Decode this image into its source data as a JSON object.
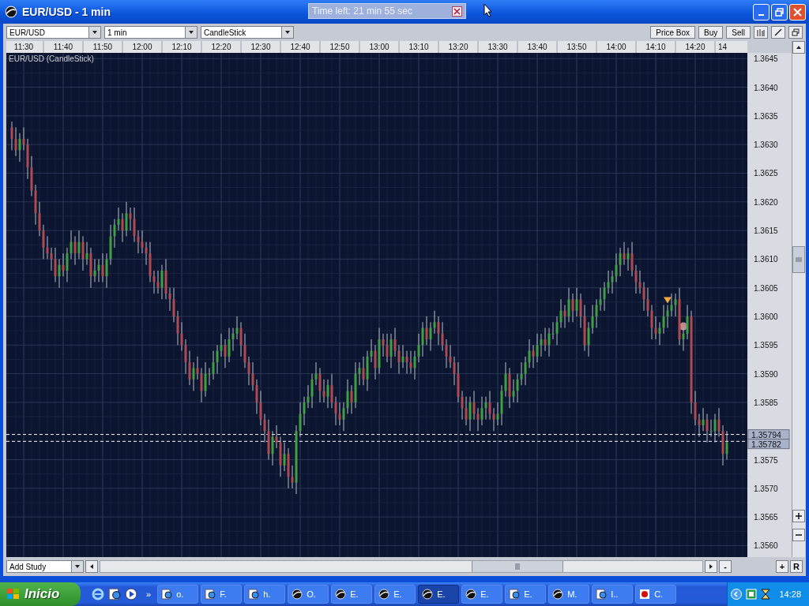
{
  "window": {
    "title": "EUR/USD - 1 min"
  },
  "timer_popup": {
    "text": "Time left: 21 min 55 sec"
  },
  "toolbar": {
    "symbol_select": "EUR/USD",
    "interval_select": "1 min",
    "chart_type_select": "CandleStick",
    "buttons": [
      "Price Box",
      "Buy",
      "Sell"
    ]
  },
  "chart": {
    "cut_time_label": "14",
    "chart_data": {
      "type": "candlestick",
      "title": "EUR/USD (CandleStick)",
      "x": [
        11.45,
        11.4667,
        11.4833,
        11.5,
        11.5167,
        11.5333,
        11.55,
        11.5667,
        11.5833,
        11.6,
        11.6167,
        11.6333,
        11.65,
        11.6667,
        11.6833,
        11.7,
        11.7167,
        11.7333,
        11.75,
        11.7667,
        11.7833,
        11.8,
        11.8167,
        11.8333,
        11.85,
        11.8667,
        11.8833,
        11.9,
        11.9167,
        11.9333,
        11.95,
        11.9667,
        11.9833,
        12,
        12.0167,
        12.0333,
        12.05,
        12.0667,
        12.0833,
        12.1,
        12.1167,
        12.1333,
        12.15,
        12.1667,
        12.1833,
        12.2,
        12.2167,
        12.2333,
        12.25,
        12.2667,
        12.2833,
        12.3,
        12.3167,
        12.3333,
        12.35,
        12.3667,
        12.3833,
        12.4,
        12.4167,
        12.4333,
        12.45,
        12.4667,
        12.4833,
        12.5,
        12.5167,
        12.5333,
        12.55,
        12.5667,
        12.5833,
        12.6,
        12.6167,
        12.6333,
        12.65,
        12.6667,
        12.6833,
        12.7,
        12.7167,
        12.7333,
        12.75,
        12.7667,
        12.7833,
        12.8,
        12.8167,
        12.8333,
        12.85,
        12.8667,
        12.8833,
        12.9,
        12.9167,
        12.9333,
        12.95,
        12.9667,
        12.9833,
        13,
        13.0167,
        13.0333,
        13.05,
        13.0667,
        13.0833,
        13.1,
        13.1167,
        13.1333,
        13.15,
        13.1667,
        13.1833,
        13.2,
        13.2167,
        13.2333,
        13.25,
        13.2667,
        13.2833,
        13.3,
        13.3167,
        13.3333,
        13.35,
        13.3667,
        13.3833,
        13.4,
        13.4167,
        13.4333,
        13.45,
        13.4667,
        13.4833,
        13.5,
        13.5167,
        13.5333,
        13.55,
        13.5667,
        13.5833,
        13.6,
        13.6167,
        13.6333,
        13.65,
        13.6667,
        13.6833,
        13.7,
        13.7167,
        13.7333,
        13.75,
        13.7667,
        13.7833,
        13.8,
        13.8167,
        13.8333,
        13.85,
        13.8667,
        13.8833,
        13.9,
        13.9167,
        13.9333,
        13.95,
        13.9667,
        13.9833,
        14,
        14.0167,
        14.0333,
        14.05,
        14.0667,
        14.0833,
        14.1,
        14.1167,
        14.1333,
        14.15,
        14.1667,
        14.1833,
        14.2,
        14.2167,
        14.2333,
        14.25,
        14.2667,
        14.2833,
        14.3,
        14.3167,
        14.3333,
        14.35,
        14.3667,
        14.3833,
        14.4,
        14.4167,
        14.4333,
        14.45,
        14.4667
      ],
      "grid": true,
      "xlim": [
        11.4267,
        14.5533
      ],
      "ohlc": [
        [
          1.3633,
          1.3634,
          1.3629,
          1.3631
        ],
        [
          1.3631,
          1.3633,
          1.3628,
          1.3629
        ],
        [
          1.3629,
          1.3632,
          1.3627,
          1.3631
        ],
        [
          1.3631,
          1.3633,
          1.3629,
          1.363
        ],
        [
          1.363,
          1.3631,
          1.3624,
          1.3626
        ],
        [
          1.3626,
          1.3628,
          1.3621,
          1.3622
        ],
        [
          1.3622,
          1.3623,
          1.3616,
          1.3618
        ],
        [
          1.3618,
          1.362,
          1.3614,
          1.3615
        ],
        [
          1.3615,
          1.3616,
          1.361,
          1.3612
        ],
        [
          1.3612,
          1.3614,
          1.361,
          1.3611
        ],
        [
          1.3611,
          1.3612,
          1.3608,
          1.361
        ],
        [
          1.361,
          1.3612,
          1.3606,
          1.3607
        ],
        [
          1.3607,
          1.361,
          1.3605,
          1.3609
        ],
        [
          1.3609,
          1.3611,
          1.3607,
          1.3608
        ],
        [
          1.3608,
          1.3612,
          1.3606,
          1.3611
        ],
        [
          1.3611,
          1.3615,
          1.361,
          1.3613
        ],
        [
          1.3613,
          1.3614,
          1.3609,
          1.3611
        ],
        [
          1.3611,
          1.3615,
          1.361,
          1.3613
        ],
        [
          1.3613,
          1.3614,
          1.3608,
          1.361
        ],
        [
          1.361,
          1.3613,
          1.3609,
          1.3611
        ],
        [
          1.3611,
          1.3612,
          1.3605,
          1.3607
        ],
        [
          1.3607,
          1.361,
          1.3606,
          1.3608
        ],
        [
          1.3608,
          1.361,
          1.3606,
          1.3609
        ],
        [
          1.3609,
          1.3611,
          1.3606,
          1.3607
        ],
        [
          1.3607,
          1.3611,
          1.3605,
          1.361
        ],
        [
          1.361,
          1.3616,
          1.3609,
          1.3614
        ],
        [
          1.3614,
          1.3617,
          1.3612,
          1.3616
        ],
        [
          1.3616,
          1.3619,
          1.3615,
          1.3617
        ],
        [
          1.3617,
          1.3618,
          1.3613,
          1.3615
        ],
        [
          1.3615,
          1.362,
          1.3614,
          1.3618
        ],
        [
          1.3618,
          1.3619,
          1.3615,
          1.3617
        ],
        [
          1.3617,
          1.3619,
          1.3613,
          1.3614
        ],
        [
          1.3614,
          1.3615,
          1.3611,
          1.3613
        ],
        [
          1.3613,
          1.3615,
          1.3611,
          1.3612
        ],
        [
          1.3612,
          1.3613,
          1.3609,
          1.3611
        ],
        [
          1.3611,
          1.3613,
          1.3606,
          1.3607
        ],
        [
          1.3607,
          1.3608,
          1.3604,
          1.3606
        ],
        [
          1.3606,
          1.3608,
          1.3604,
          1.3605
        ],
        [
          1.3605,
          1.3609,
          1.3603,
          1.3608
        ],
        [
          1.3608,
          1.361,
          1.3603,
          1.3604
        ],
        [
          1.3604,
          1.3605,
          1.3601,
          1.3603
        ],
        [
          1.3603,
          1.3605,
          1.3599,
          1.36
        ],
        [
          1.36,
          1.3601,
          1.3595,
          1.3597
        ],
        [
          1.3597,
          1.3599,
          1.3594,
          1.3595
        ],
        [
          1.3595,
          1.3596,
          1.359,
          1.3592
        ],
        [
          1.3592,
          1.3594,
          1.3588,
          1.3589
        ],
        [
          1.3589,
          1.3592,
          1.3587,
          1.3591
        ],
        [
          1.3591,
          1.3593,
          1.3589,
          1.359
        ],
        [
          1.359,
          1.3591,
          1.3585,
          1.3587
        ],
        [
          1.3587,
          1.3592,
          1.3586,
          1.359
        ],
        [
          1.359,
          1.3591,
          1.3588,
          1.359
        ],
        [
          1.359,
          1.3594,
          1.3589,
          1.3592
        ],
        [
          1.3592,
          1.3595,
          1.359,
          1.3594
        ],
        [
          1.3594,
          1.3597,
          1.3593,
          1.3595
        ],
        [
          1.3595,
          1.3596,
          1.3591,
          1.3593
        ],
        [
          1.3593,
          1.3598,
          1.3592,
          1.3596
        ],
        [
          1.3596,
          1.3598,
          1.3594,
          1.3597
        ],
        [
          1.3597,
          1.36,
          1.3596,
          1.3598
        ],
        [
          1.3598,
          1.3599,
          1.3593,
          1.3595
        ],
        [
          1.3595,
          1.3597,
          1.3591,
          1.3592
        ],
        [
          1.3592,
          1.3593,
          1.3588,
          1.359
        ],
        [
          1.359,
          1.3592,
          1.3587,
          1.3588
        ],
        [
          1.3588,
          1.3589,
          1.3583,
          1.3585
        ],
        [
          1.3585,
          1.3587,
          1.3581,
          1.3582
        ],
        [
          1.3582,
          1.3583,
          1.3578,
          1.358
        ],
        [
          1.358,
          1.3582,
          1.3575,
          1.3576
        ],
        [
          1.3576,
          1.358,
          1.3574,
          1.3579
        ],
        [
          1.3579,
          1.3581,
          1.3577,
          1.3578
        ],
        [
          1.3578,
          1.3579,
          1.3572,
          1.3574
        ],
        [
          1.3574,
          1.3578,
          1.3573,
          1.3576
        ],
        [
          1.3576,
          1.3577,
          1.357,
          1.3572
        ],
        [
          1.3572,
          1.3574,
          1.357,
          1.3571
        ],
        [
          1.3571,
          1.3581,
          1.3569,
          1.358
        ],
        [
          1.358,
          1.3585,
          1.3579,
          1.3583
        ],
        [
          1.3583,
          1.3586,
          1.3581,
          1.3585
        ],
        [
          1.3585,
          1.3588,
          1.3584,
          1.3586
        ],
        [
          1.3586,
          1.359,
          1.3584,
          1.3589
        ],
        [
          1.3589,
          1.3592,
          1.3588,
          1.359
        ],
        [
          1.359,
          1.3591,
          1.3585,
          1.3587
        ],
        [
          1.3587,
          1.3589,
          1.3585,
          1.3586
        ],
        [
          1.3586,
          1.3589,
          1.3584,
          1.3588
        ],
        [
          1.3588,
          1.359,
          1.3584,
          1.3585
        ],
        [
          1.3585,
          1.3586,
          1.3581,
          1.3583
        ],
        [
          1.3583,
          1.3585,
          1.3581,
          1.3582
        ],
        [
          1.3582,
          1.3585,
          1.358,
          1.3584
        ],
        [
          1.3584,
          1.3589,
          1.3583,
          1.3587
        ],
        [
          1.3587,
          1.3588,
          1.3583,
          1.3585
        ],
        [
          1.3585,
          1.3592,
          1.3584,
          1.359
        ],
        [
          1.359,
          1.3592,
          1.3588,
          1.3591
        ],
        [
          1.3591,
          1.3593,
          1.3588,
          1.3589
        ],
        [
          1.3589,
          1.3594,
          1.3587,
          1.3593
        ],
        [
          1.3593,
          1.3596,
          1.3592,
          1.3594
        ],
        [
          1.3594,
          1.3595,
          1.3589,
          1.3591
        ],
        [
          1.3591,
          1.3598,
          1.359,
          1.3596
        ],
        [
          1.3596,
          1.3597,
          1.3593,
          1.3595
        ],
        [
          1.3595,
          1.3597,
          1.3592,
          1.3593
        ],
        [
          1.3593,
          1.3597,
          1.3591,
          1.3596
        ],
        [
          1.3596,
          1.3598,
          1.3593,
          1.3594
        ],
        [
          1.3594,
          1.3595,
          1.359,
          1.3592
        ],
        [
          1.3592,
          1.3595,
          1.3591,
          1.3593
        ],
        [
          1.3593,
          1.3594,
          1.359,
          1.3592
        ],
        [
          1.3592,
          1.3594,
          1.359,
          1.3591
        ],
        [
          1.3591,
          1.3594,
          1.3589,
          1.3593
        ],
        [
          1.3593,
          1.3597,
          1.3592,
          1.3595
        ],
        [
          1.3595,
          1.3599,
          1.3593,
          1.3598
        ],
        [
          1.3598,
          1.36,
          1.3595,
          1.3596
        ],
        [
          1.3596,
          1.3599,
          1.3594,
          1.3598
        ],
        [
          1.3598,
          1.3601,
          1.3597,
          1.3599
        ],
        [
          1.3599,
          1.36,
          1.3595,
          1.3597
        ],
        [
          1.3597,
          1.3599,
          1.3594,
          1.3595
        ],
        [
          1.3595,
          1.3596,
          1.3591,
          1.3593
        ],
        [
          1.3593,
          1.3595,
          1.3591,
          1.3592
        ],
        [
          1.3592,
          1.3593,
          1.3588,
          1.359
        ],
        [
          1.359,
          1.3592,
          1.3585,
          1.3586
        ],
        [
          1.3586,
          1.3587,
          1.3582,
          1.3584
        ],
        [
          1.3584,
          1.3586,
          1.3581,
          1.3582
        ],
        [
          1.3582,
          1.3586,
          1.358,
          1.3585
        ],
        [
          1.3585,
          1.3587,
          1.3582,
          1.3583
        ],
        [
          1.3583,
          1.3584,
          1.358,
          1.3582
        ],
        [
          1.3582,
          1.3586,
          1.3581,
          1.3584
        ],
        [
          1.3584,
          1.3586,
          1.3582,
          1.3585
        ],
        [
          1.3585,
          1.3587,
          1.3582,
          1.3583
        ],
        [
          1.3583,
          1.3584,
          1.358,
          1.3582
        ],
        [
          1.3582,
          1.3585,
          1.3581,
          1.3583
        ],
        [
          1.3583,
          1.3588,
          1.3581,
          1.3587
        ],
        [
          1.3587,
          1.3592,
          1.3586,
          1.359
        ],
        [
          1.359,
          1.3591,
          1.3584,
          1.3586
        ],
        [
          1.3586,
          1.3589,
          1.3585,
          1.3587
        ],
        [
          1.3587,
          1.359,
          1.3585,
          1.3589
        ],
        [
          1.3589,
          1.3592,
          1.3588,
          1.359
        ],
        [
          1.359,
          1.3593,
          1.3588,
          1.3592
        ],
        [
          1.3592,
          1.3596,
          1.3591,
          1.3594
        ],
        [
          1.3594,
          1.3595,
          1.3591,
          1.3593
        ],
        [
          1.3593,
          1.3597,
          1.3592,
          1.3595
        ],
        [
          1.3595,
          1.3597,
          1.3593,
          1.3596
        ],
        [
          1.3596,
          1.3598,
          1.3594,
          1.3595
        ],
        [
          1.3595,
          1.3598,
          1.3593,
          1.3597
        ],
        [
          1.3597,
          1.3599,
          1.3596,
          1.3597
        ],
        [
          1.3597,
          1.36,
          1.3595,
          1.3599
        ],
        [
          1.3599,
          1.3603,
          1.3598,
          1.3601
        ],
        [
          1.3601,
          1.3602,
          1.3598,
          1.36
        ],
        [
          1.36,
          1.3605,
          1.3599,
          1.3603
        ],
        [
          1.3603,
          1.3604,
          1.3599,
          1.3601
        ],
        [
          1.3601,
          1.3605,
          1.36,
          1.3603
        ],
        [
          1.3603,
          1.3604,
          1.3598,
          1.36
        ],
        [
          1.36,
          1.3602,
          1.3594,
          1.3595
        ],
        [
          1.3595,
          1.3599,
          1.3593,
          1.3598
        ],
        [
          1.3598,
          1.3602,
          1.3597,
          1.36
        ],
        [
          1.36,
          1.3603,
          1.3598,
          1.3602
        ],
        [
          1.3602,
          1.3605,
          1.3601,
          1.3603
        ],
        [
          1.3603,
          1.3606,
          1.3601,
          1.3605
        ],
        [
          1.3605,
          1.3608,
          1.3604,
          1.3606
        ],
        [
          1.3606,
          1.3608,
          1.3604,
          1.3607
        ],
        [
          1.3607,
          1.3611,
          1.3606,
          1.3609
        ],
        [
          1.3609,
          1.3612,
          1.3607,
          1.3611
        ],
        [
          1.3611,
          1.3613,
          1.3609,
          1.361
        ],
        [
          1.361,
          1.3612,
          1.3608,
          1.3611
        ],
        [
          1.3611,
          1.3613,
          1.3607,
          1.3608
        ],
        [
          1.3608,
          1.3609,
          1.3604,
          1.3606
        ],
        [
          1.3606,
          1.3608,
          1.3604,
          1.3605
        ],
        [
          1.3605,
          1.3606,
          1.3601,
          1.3603
        ],
        [
          1.3603,
          1.3605,
          1.36,
          1.3601
        ],
        [
          1.3601,
          1.3602,
          1.3596,
          1.3598
        ],
        [
          1.3598,
          1.36,
          1.3596,
          1.3597
        ],
        [
          1.3597,
          1.3599,
          1.3595,
          1.3598
        ],
        [
          1.3598,
          1.3602,
          1.3597,
          1.36
        ],
        [
          1.36,
          1.3602,
          1.3598,
          1.3601
        ],
        [
          1.3601,
          1.3604,
          1.36,
          1.3602
        ],
        [
          1.3602,
          1.3604,
          1.36,
          1.3603
        ],
        [
          1.3603,
          1.3605,
          1.3595,
          1.3596
        ],
        [
          1.3596,
          1.3598,
          1.3594,
          1.3597
        ],
        [
          1.3597,
          1.3602,
          1.3596,
          1.36
        ],
        [
          1.36,
          1.3601,
          1.3583,
          1.3585
        ],
        [
          1.3585,
          1.3587,
          1.3581,
          1.3582
        ],
        [
          1.3582,
          1.3583,
          1.3579,
          1.3581
        ],
        [
          1.3581,
          1.3584,
          1.358,
          1.3582
        ],
        [
          1.3582,
          1.3583,
          1.3578,
          1.358
        ],
        [
          1.358,
          1.3582,
          1.3579,
          1.358
        ],
        [
          1.358,
          1.3583,
          1.3578,
          1.3582
        ],
        [
          1.3582,
          1.3584,
          1.3579,
          1.358
        ],
        [
          1.358,
          1.3581,
          1.3574,
          1.3576
        ],
        [
          1.3576,
          1.358,
          1.3575,
          1.3578
        ]
      ],
      "ylim": [
        1.3558,
        1.3646
      ],
      "xticks": [
        {
          "value": 11.5,
          "label": "11:30"
        },
        {
          "value": 11.6667,
          "label": "11:40"
        },
        {
          "value": 11.8333,
          "label": "11:50"
        },
        {
          "value": 12,
          "label": "12:00"
        },
        {
          "value": 12.1667,
          "label": "12:10"
        },
        {
          "value": 12.3333,
          "label": "12:20"
        },
        {
          "value": 12.5,
          "label": "12:30"
        },
        {
          "value": 12.6667,
          "label": "12:40"
        },
        {
          "value": 12.8333,
          "label": "12:50"
        },
        {
          "value": 13,
          "label": "13:00"
        },
        {
          "value": 13.1667,
          "label": "13:10"
        },
        {
          "value": 13.3333,
          "label": "13:20"
        },
        {
          "value": 13.5,
          "label": "13:30"
        },
        {
          "value": 13.6667,
          "label": "13:40"
        },
        {
          "value": 13.8333,
          "label": "13:50"
        },
        {
          "value": 14,
          "label": "14:00"
        },
        {
          "value": 14.1667,
          "label": "14:10"
        },
        {
          "value": 14.3333,
          "label": "14:20"
        }
      ],
      "yticks": [
        {
          "value": 1.3645,
          "label": "1.3645"
        },
        {
          "value": 1.364,
          "label": "1.3640"
        },
        {
          "value": 1.3635,
          "label": "1.3635"
        },
        {
          "value": 1.363,
          "label": "1.3630"
        },
        {
          "value": 1.3625,
          "label": "1.3625"
        },
        {
          "value": 1.362,
          "label": "1.3620"
        },
        {
          "value": 1.3615,
          "label": "1.3615"
        },
        {
          "value": 1.361,
          "label": "1.3610"
        },
        {
          "value": 1.3605,
          "label": "1.3605"
        },
        {
          "value": 1.36,
          "label": "1.3600"
        },
        {
          "value": 1.3595,
          "label": "1.3595"
        },
        {
          "value": 1.359,
          "label": "1.3590"
        },
        {
          "value": 1.3585,
          "label": "1.3585"
        },
        {
          "value": 1.3575,
          "label": "1.3575"
        },
        {
          "value": 1.357,
          "label": "1.3570"
        },
        {
          "value": 1.3565,
          "label": "1.3565"
        },
        {
          "value": 1.356,
          "label": "1.3560"
        }
      ],
      "ref_lines": [
        {
          "axis": "y",
          "value": 1.35794,
          "label": "1.35794"
        },
        {
          "axis": "y",
          "value": 1.35782,
          "label": "1.35782"
        }
      ]
    }
  },
  "bottom_bar": {
    "study_select": "Add Study",
    "zoom_buttons": [
      "-",
      "+",
      "R"
    ]
  },
  "taskbar": {
    "start": "Inicio",
    "more": "»",
    "tasks": [
      {
        "label": "o.",
        "kind": "browser",
        "selected": false
      },
      {
        "label": "F.",
        "kind": "browser",
        "selected": false
      },
      {
        "label": "h.",
        "kind": "browser",
        "selected": false
      },
      {
        "label": "O.",
        "kind": "app",
        "selected": false
      },
      {
        "label": "E.",
        "kind": "app",
        "selected": false
      },
      {
        "label": "E.",
        "kind": "app",
        "selected": false
      },
      {
        "label": "E.",
        "kind": "app",
        "selected": true
      },
      {
        "label": "E.",
        "kind": "app",
        "selected": false
      },
      {
        "label": "E.",
        "kind": "browser",
        "selected": false
      },
      {
        "label": "M.",
        "kind": "app",
        "selected": false
      },
      {
        "label": "I..",
        "kind": "browser",
        "selected": false
      },
      {
        "label": "C.",
        "kind": "paint",
        "selected": false
      }
    ],
    "clock": "14:28"
  }
}
